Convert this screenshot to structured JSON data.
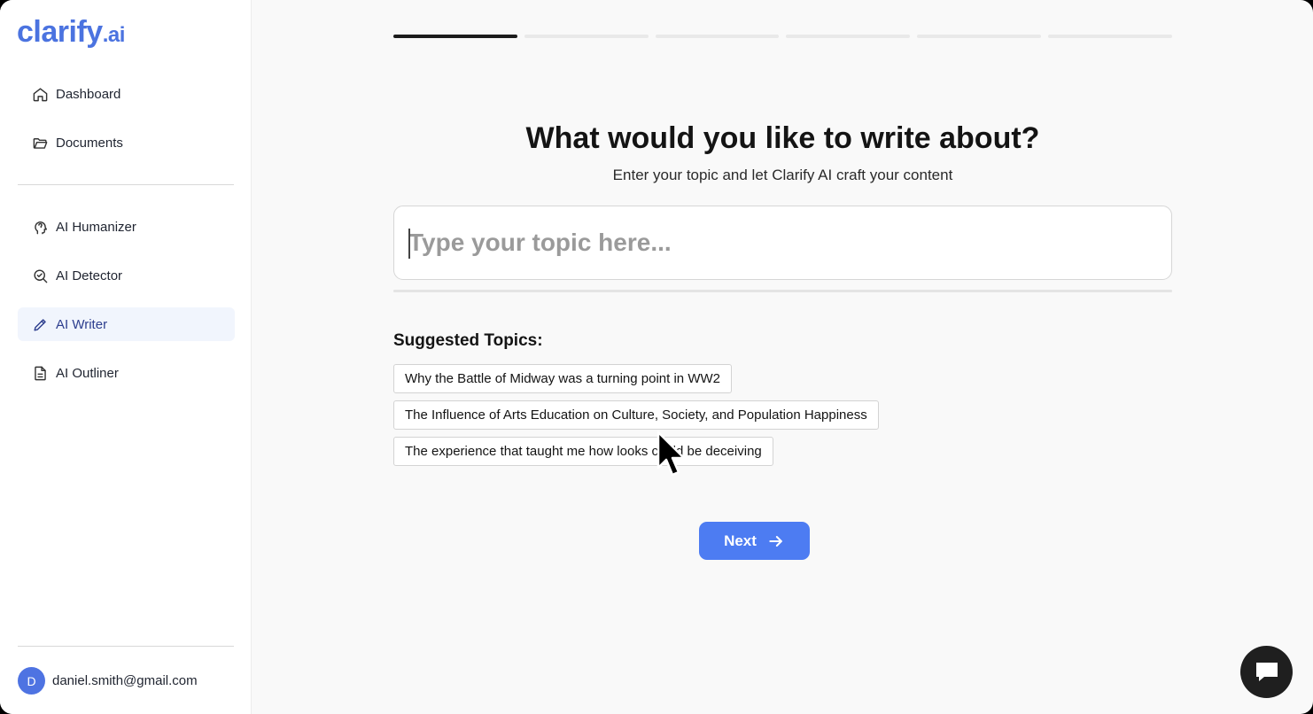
{
  "app": {
    "logo_main": "clarify",
    "logo_suffix": ".ai",
    "brand_color": "#4b73e0"
  },
  "sidebar": {
    "top_items": [
      {
        "label": "Dashboard",
        "icon": "home-icon"
      },
      {
        "label": "Documents",
        "icon": "folder-icon"
      }
    ],
    "tool_items": [
      {
        "label": "AI Humanizer",
        "icon": "head-brain-icon"
      },
      {
        "label": "AI Detector",
        "icon": "magnify-check-icon"
      },
      {
        "label": "AI Writer",
        "icon": "pencil-icon",
        "active": true
      },
      {
        "label": "AI Outliner",
        "icon": "document-icon"
      }
    ],
    "user": {
      "avatar_initial": "D",
      "email": "daniel.smith@gmail.com"
    }
  },
  "progress": {
    "total_steps": 6,
    "current_step": 1
  },
  "main": {
    "heading": "What would you like to write about?",
    "subheading": "Enter your topic and let Clarify AI craft your content",
    "topic_input": {
      "placeholder": "Type your topic here...",
      "value": ""
    },
    "suggested_title": "Suggested Topics:",
    "suggested_topics": [
      "Why the Battle of Midway was a turning point in WW2",
      "The Influence of Arts Education on Culture, Society, and Population Happiness",
      "The experience that taught me how looks could be deceiving"
    ],
    "next_label": "Next"
  },
  "chat": {
    "icon": "chat-bubble-icon"
  }
}
